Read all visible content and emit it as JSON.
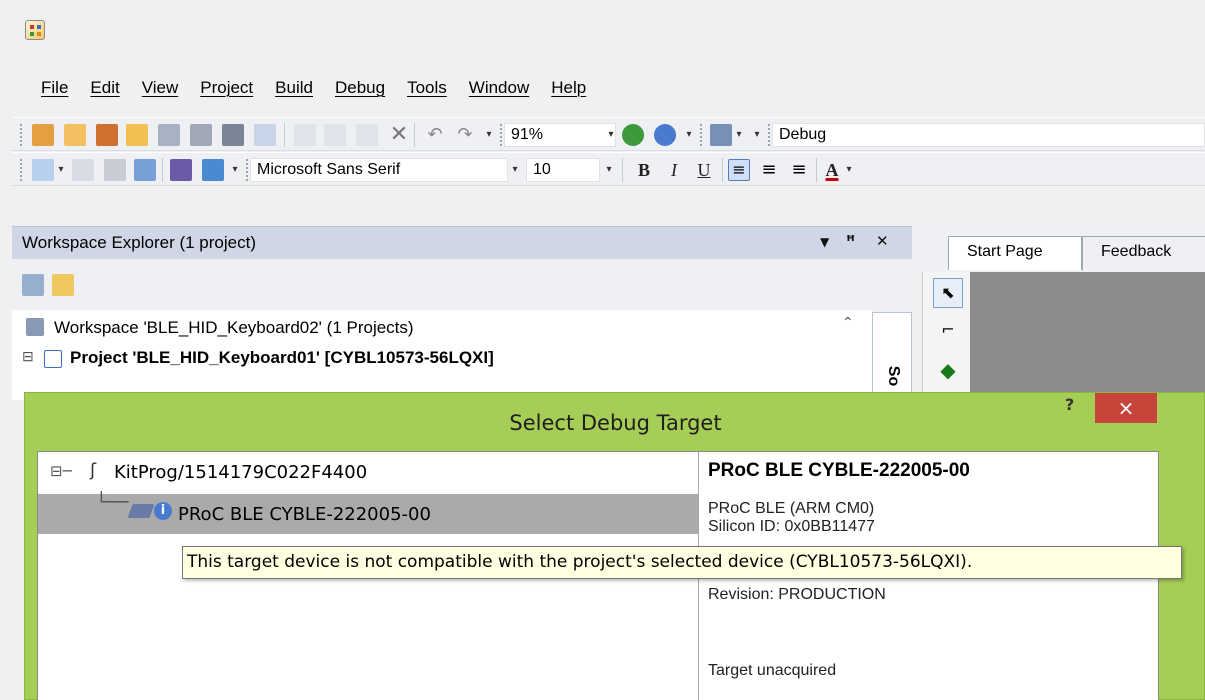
{
  "menu": [
    "File",
    "Edit",
    "View",
    "Project",
    "Build",
    "Debug",
    "Tools",
    "Window",
    "Help"
  ],
  "toolbar1": {
    "zoom": "91%",
    "config": "Debug"
  },
  "toolbar2": {
    "font_name": "Microsoft Sans Serif",
    "font_size": "10",
    "bold": "B",
    "italic": "I",
    "underline": "U",
    "font_color": "A"
  },
  "workspace": {
    "title": "Workspace Explorer (1 project)",
    "tree": [
      "Workspace 'BLE_HID_Keyboard02' (1 Projects)",
      "Project  'BLE_HID_Keyboard01' [CYBL10573-56LQXI]"
    ],
    "side_tab": "So"
  },
  "tabs": [
    "Start Page",
    "Feedback"
  ],
  "dialog": {
    "title": "Select Debug Target",
    "help": "?",
    "close": "×",
    "probe": "KitProg/1514179C022F4400",
    "device": "PRoC BLE CYBLE-222005-00",
    "info_title": "PRoC BLE CYBLE-222005-00",
    "info_lines": [
      "PRoC BLE (ARM CM0)",
      "Silicon ID: 0x0BB11477",
      "Revision: PRODUCTION",
      "Target unacquired"
    ]
  },
  "tooltip": "This target device is not compatible with the project's selected device (CYBL10573-56LQXI).",
  "colors": {
    "dialog_frame": "#a6cd55",
    "close_button": "#c7443a",
    "selection": "#aaaaaa",
    "tooltip_bg": "#ffffe1"
  }
}
